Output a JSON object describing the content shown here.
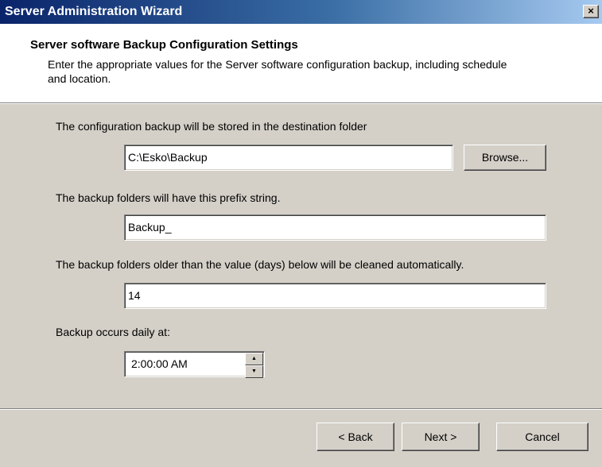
{
  "window": {
    "title": "Server Administration Wizard",
    "close_label": "×"
  },
  "header": {
    "title": "Server software Backup Configuration Settings",
    "description": "Enter the appropriate values for the Server software configuration backup, including schedule and location."
  },
  "form": {
    "destination_label": "The configuration backup will be stored in the destination folder",
    "destination_value": "C:\\Esko\\Backup",
    "browse_label": "Browse...",
    "prefix_label": "The backup folders will have this prefix string.",
    "prefix_value": "Backup_",
    "cleanup_label": "The backup folders older than the value (days) below will be cleaned automatically.",
    "cleanup_value": "14",
    "time_label": "Backup occurs daily at:",
    "time_value": "2:00:00 AM",
    "spin_up_glyph": "▲",
    "spin_down_glyph": "▼"
  },
  "footer": {
    "back_label": "< Back",
    "next_label": "Next >",
    "cancel_label": "Cancel"
  }
}
